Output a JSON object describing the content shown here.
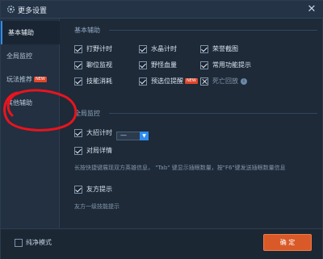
{
  "window": {
    "title": "更多设置"
  },
  "sidebar": {
    "items": [
      {
        "label": "基本辅助",
        "active": true,
        "badge": ""
      },
      {
        "label": "全局监控",
        "active": false,
        "badge": ""
      },
      {
        "label": "玩法推荐",
        "active": false,
        "badge": "NEW"
      },
      {
        "label": "其他辅助",
        "active": false,
        "badge": ""
      }
    ]
  },
  "basic": {
    "title": "基本辅助",
    "options": [
      {
        "label": "打野计时",
        "checked": true
      },
      {
        "label": "水晶计时",
        "checked": true
      },
      {
        "label": "荣誉截图",
        "checked": true
      },
      {
        "label": "聊位监视",
        "checked": true
      },
      {
        "label": "野怪血量",
        "checked": true
      },
      {
        "label": "常用功能提示",
        "checked": true
      },
      {
        "label": "技能消耗",
        "checked": true
      },
      {
        "label": "预选位提醒",
        "checked": true,
        "badge": "NEW"
      },
      {
        "label": "死亡回放",
        "checked": false,
        "info": "i"
      }
    ]
  },
  "global": {
    "title": "全局监控",
    "ult_timer": "大招计时",
    "details": "对局详情",
    "details_select": "—",
    "hint1": "长按快捷键展现双方英雄信息， \"Tab\" 键显示插眼数量，按\"F6\"键发送插眼数量信息",
    "friend_tip": "友方提示",
    "hint2": "友方一级技能提示"
  },
  "footer": {
    "pure_mode": "纯净模式",
    "ok": "确 定"
  },
  "colors": {
    "accent": "#2d8cf0",
    "ok_button": "#d95a28",
    "badge": "#e0452a",
    "annotation": "#e8141e"
  }
}
